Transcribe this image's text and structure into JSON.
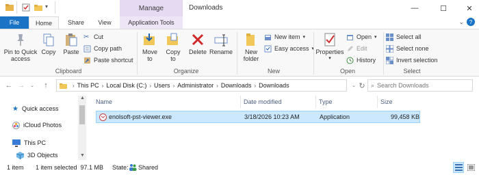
{
  "titlebar": {
    "manage_label": "Manage",
    "title": "Downloads",
    "minimize_glyph": "—",
    "maximize_glyph": "☐",
    "close_glyph": "✕"
  },
  "tabs": {
    "file": "File",
    "home": "Home",
    "share": "Share",
    "view": "View",
    "app_tools": "Application Tools"
  },
  "ribbon": {
    "clipboard": {
      "pin": "Pin to Quick access",
      "copy": "Copy",
      "paste": "Paste",
      "cut": "Cut",
      "copy_path": "Copy path",
      "paste_shortcut": "Paste shortcut",
      "label": "Clipboard"
    },
    "organize": {
      "move_to": "Move to",
      "copy_to": "Copy to",
      "delete": "Delete",
      "rename": "Rename",
      "label": "Organize"
    },
    "new": {
      "new_folder": "New folder",
      "new_item": "New item",
      "easy_access": "Easy access",
      "label": "New"
    },
    "open": {
      "properties": "Properties",
      "open": "Open",
      "edit": "Edit",
      "history": "History",
      "label": "Open"
    },
    "select": {
      "select_all": "Select all",
      "select_none": "Select none",
      "invert": "Invert selection",
      "label": "Select"
    }
  },
  "address": {
    "crumbs": [
      "This PC",
      "Local Disk (C:)",
      "Users",
      "Administrator",
      "Downloads",
      "Downloads"
    ],
    "search_placeholder": "Search Downloads"
  },
  "navpane": {
    "items": [
      "Quick access",
      "iCloud Photos",
      "This PC",
      "3D Objects"
    ]
  },
  "list": {
    "columns": [
      "Name",
      "Date modified",
      "Type",
      "Size"
    ],
    "files": [
      {
        "name": "enolsoft-pst-viewer.exe",
        "date": "3/18/2026 10:23 AM",
        "type": "Application",
        "size": "99,458 KB"
      }
    ]
  },
  "status": {
    "count": "1 item",
    "selected": "1 item selected  97.1 MB",
    "state": "State:",
    "shared": "Shared"
  },
  "colors": {
    "accent": "#1a73c4",
    "manage_tab": "#e6d9f2",
    "selection": "#cce8ff"
  }
}
